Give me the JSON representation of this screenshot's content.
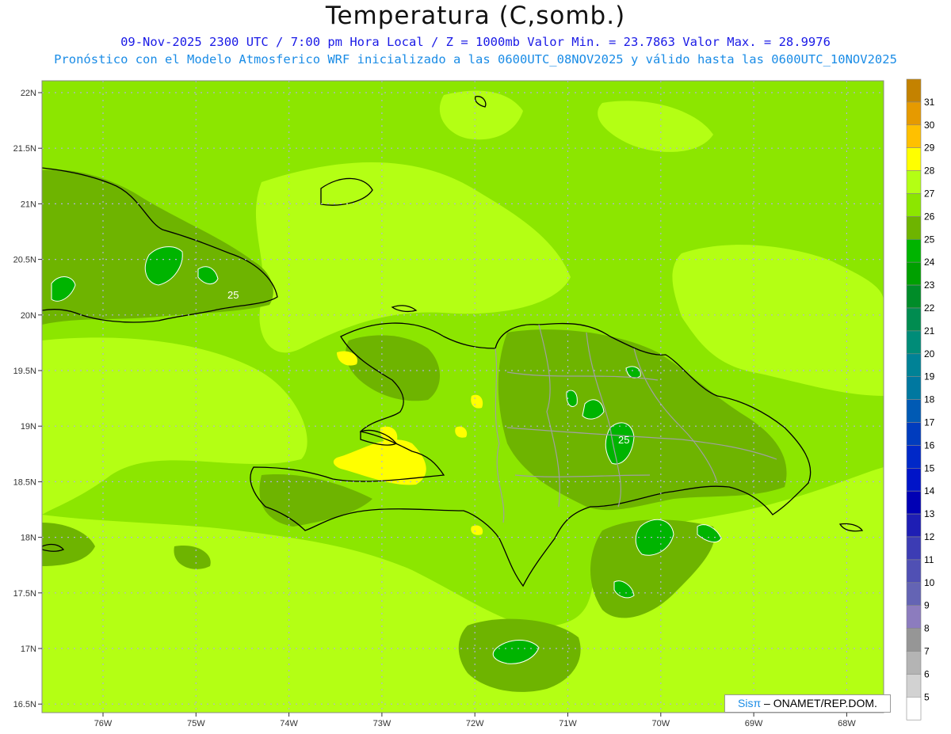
{
  "header": {
    "title": "Temperatura (C,somb.)",
    "line1": "09-Nov-2025  2300 UTC / 7:00 pm Hora Local / Z = 1000mb   Valor Min. = 23.7863  Valor Max. = 28.9976",
    "line2": "Pronóstico con el Modelo Atmosferico WRF inicializado a las 0600UTC_08NOV2025 y válido hasta las  0600UTC_10NOV2025"
  },
  "map": {
    "lat_labels": [
      "22N",
      "21.5N",
      "21N",
      "20.5N",
      "20N",
      "19.5N",
      "19N",
      "18.5N",
      "18N",
      "17.5N",
      "17N",
      "16.5N"
    ],
    "lon_labels": [
      "76W",
      "75W",
      "74W",
      "73W",
      "72W",
      "71W",
      "70W",
      "69W",
      "68W"
    ],
    "contour_labels": [
      "25",
      "25"
    ],
    "valor_min": 23.7863,
    "valor_max": 28.9976
  },
  "colorbar": {
    "levels": [
      "31",
      "30",
      "29",
      "28",
      "27",
      "26",
      "25",
      "24",
      "23",
      "22",
      "21",
      "20",
      "19",
      "18",
      "17",
      "16",
      "15",
      "14",
      "13",
      "12",
      "11",
      "10",
      "9",
      "8",
      "7",
      "6",
      "5"
    ],
    "colors": [
      "#c48200",
      "#e69a00",
      "#ffc000",
      "#ffff00",
      "#b4ff14",
      "#8ce600",
      "#6eb400",
      "#00b400",
      "#00a000",
      "#008c28",
      "#008c50",
      "#008c78",
      "#008296",
      "#0078a0",
      "#005ab4",
      "#003cbe",
      "#0028c8",
      "#0014c8",
      "#0000b4",
      "#1e1eb4",
      "#3c3cb4",
      "#5050b4",
      "#6464b4",
      "#8c7cbe",
      "#969696",
      "#b4b4b4",
      "#d2d2d2",
      "#ffffff"
    ]
  },
  "footer": {
    "brand": "Sisπ",
    "credit": "– ONAMET/REP.DOM."
  }
}
